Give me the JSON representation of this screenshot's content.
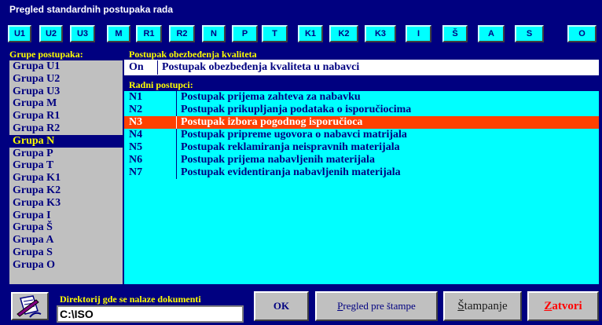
{
  "window": {
    "title": "Pregled standardnih postupaka rada"
  },
  "tabs": [
    "U1",
    "U2",
    "U3",
    "M",
    "R1",
    "R2",
    "N",
    "P",
    "T",
    "K1",
    "K2",
    "K3",
    "I",
    "Š",
    "A",
    "S",
    "O"
  ],
  "groups": {
    "label": "Grupe postupaka:",
    "selected": "Grupa N",
    "items": [
      "Grupa U1",
      "Grupa U2",
      "Grupa U3",
      "Grupa M",
      "Grupa R1",
      "Grupa R2",
      "Grupa N",
      "Grupa P",
      "Grupa T",
      "Grupa K1",
      "Grupa K2",
      "Grupa K3",
      "Grupa I",
      "Grupa Š",
      "Grupa A",
      "Grupa S",
      "Grupa O"
    ]
  },
  "quality": {
    "label": "Postupak obezbeđenja kvaliteta",
    "code": "On",
    "title": "Postupak obezbeđenja kvaliteta u nabavci"
  },
  "procedures": {
    "label": "Radni postupci:",
    "selected_code": "N3",
    "rows": [
      {
        "code": "N1",
        "name": "Postupak prijema zahteva za nabavku"
      },
      {
        "code": "N2",
        "name": "Postupak prikupljanja podataka o isporučiocima"
      },
      {
        "code": "N3",
        "name": "Postupak izbora pogodnog isporučioca"
      },
      {
        "code": "N4",
        "name": "Postupak pripreme ugovora o nabavci matrijala"
      },
      {
        "code": "N5",
        "name": "Postupak reklamiranja neispravnih materijala"
      },
      {
        "code": "N6",
        "name": "Postupak prijema nabavljenih materijala"
      },
      {
        "code": "N7",
        "name": "Postupak evidentiranja nabavljenih materijala"
      }
    ]
  },
  "footer": {
    "dir_label": "Direktorij gde se nalaze dokumenti",
    "dir_value": "C:\\ISO",
    "ok_label": "OK",
    "preview_label": "Pregled pre štampe",
    "print_label": "Štampanje",
    "close_label": "Zatvori"
  },
  "colors": {
    "background": "#000080",
    "accent_label": "#ffff00",
    "tab_bg": "#00ffff",
    "list_bg": "#00ffff",
    "selected_row": "#ff4000",
    "close_text": "#ff0000"
  },
  "icons": {
    "documents_button": "documents-folder-icon"
  }
}
